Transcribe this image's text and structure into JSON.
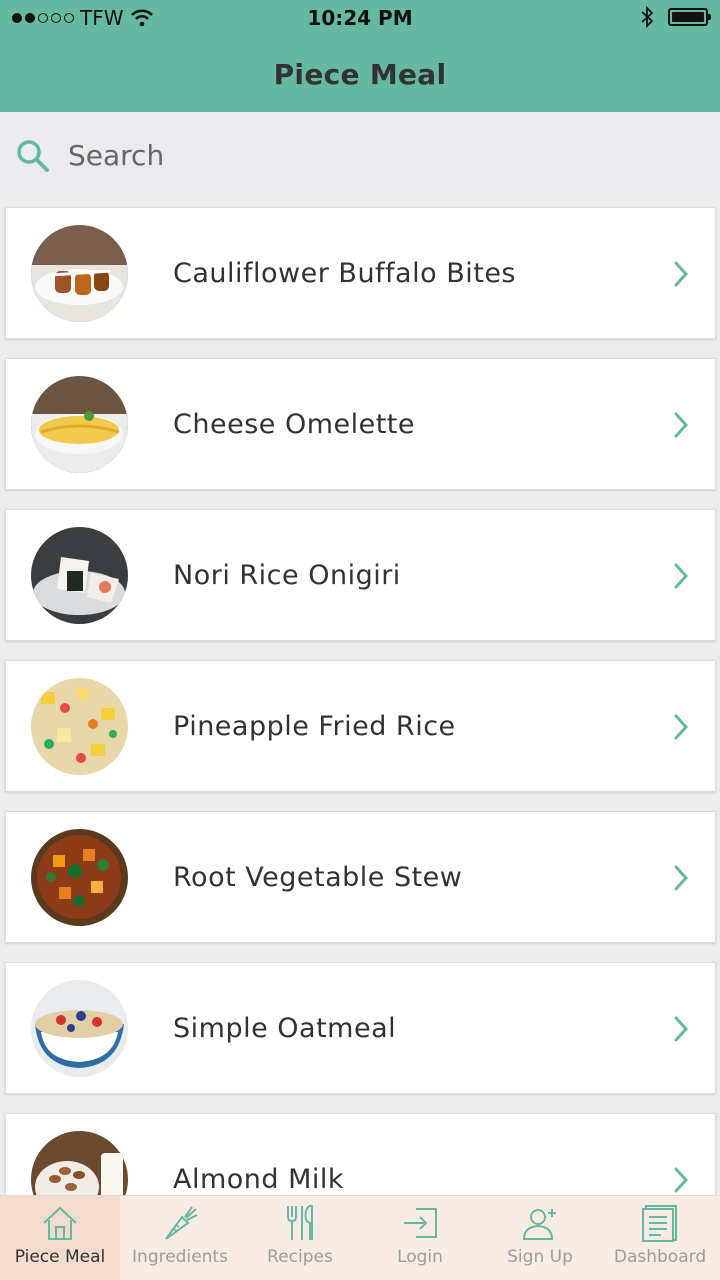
{
  "status_bar": {
    "carrier": "TFW",
    "time": "10:24 PM"
  },
  "nav": {
    "title": "Piece Meal"
  },
  "search": {
    "placeholder": "Search"
  },
  "recipes": [
    {
      "name": "Cauliflower Buffalo Bites"
    },
    {
      "name": "Cheese Omelette"
    },
    {
      "name": "Nori Rice Onigiri"
    },
    {
      "name": "Pineapple Fried Rice"
    },
    {
      "name": "Root Vegetable Stew"
    },
    {
      "name": "Simple Oatmeal"
    },
    {
      "name": "Almond Milk"
    }
  ],
  "tabs": [
    {
      "label": "Piece Meal",
      "icon": "house-icon",
      "active": true
    },
    {
      "label": "Ingredients",
      "icon": "carrot-icon",
      "active": false
    },
    {
      "label": "Recipes",
      "icon": "fork-knife-icon",
      "active": false
    },
    {
      "label": "Login",
      "icon": "login-icon",
      "active": false
    },
    {
      "label": "Sign Up",
      "icon": "add-user-icon",
      "active": false
    },
    {
      "label": "Dashboard",
      "icon": "document-icon",
      "active": false
    }
  ],
  "colors": {
    "accent": "#65b8a2",
    "tab_bar": "#f8ebe4",
    "tab_active": "#f3dccd"
  }
}
